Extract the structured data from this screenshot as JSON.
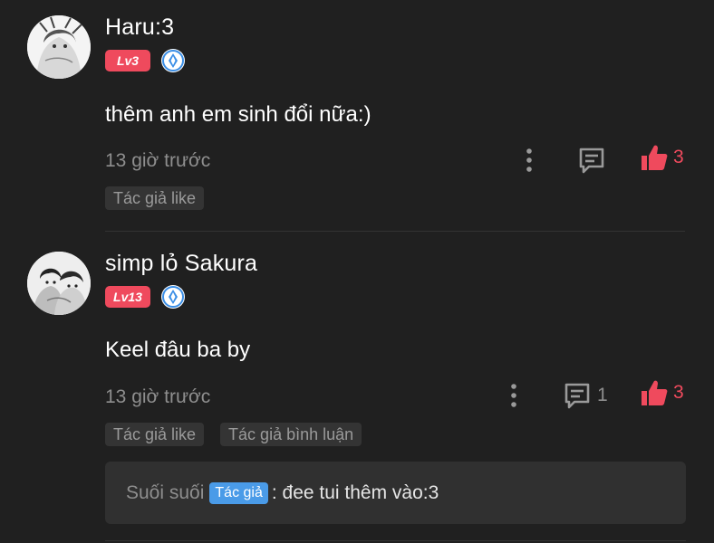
{
  "comments": [
    {
      "username": "Haru:3",
      "level": "Lv3",
      "content": "thêm anh em sinh đổi nữa:)",
      "time": "13 giờ trước",
      "reply_count": "",
      "like_count": "3",
      "tags": [
        "Tác giả like"
      ]
    },
    {
      "username": "simp lỏ Sakura",
      "level": "Lv13",
      "content": "Keel đâu ba by",
      "time": "13 giờ trước",
      "reply_count": "1",
      "like_count": "3",
      "tags": [
        "Tác giả like",
        "Tác giả bình luận"
      ],
      "reply": {
        "author": "Suối suối",
        "badge": "Tác giả",
        "text": ": đee tui thêm vào:3"
      }
    }
  ],
  "colors": {
    "background": "#202020",
    "accent_red": "#ef4a5d",
    "author_blue": "#4a9be8",
    "muted_text": "#8e8e8e"
  }
}
